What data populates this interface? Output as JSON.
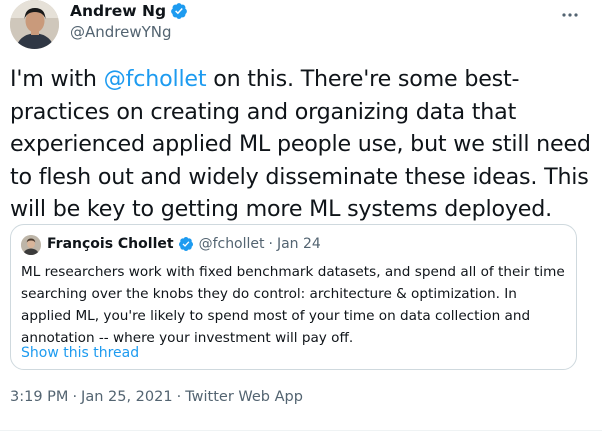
{
  "author": {
    "name": "Andrew Ng",
    "handle": "@AndrewYNg"
  },
  "tweet": {
    "text_before": "I'm with ",
    "mention": "@fchollet",
    "text_after": " on this. There're some best-practices on creating and organizing data that experienced applied ML people use, but we still need to flesh out and widely disseminate these ideas. This will be key to getting more ML systems deployed."
  },
  "quote": {
    "name": "François Chollet",
    "handle": "@fchollet",
    "date": "Jan 24",
    "text": "ML researchers work with fixed benchmark datasets, and spend all of their time searching over the knobs they do control: architecture & optimization. In applied ML, you're likely to spend most of your time on data collection and annotation -- where your investment will pay off.",
    "show_thread": "Show this thread"
  },
  "meta": {
    "time": "3:19 PM",
    "date": "Jan 25, 2021",
    "app": "Twitter Web App"
  },
  "colors": {
    "link": "#1d9bf0",
    "secondary_text": "#536471",
    "border": "#cfd9de"
  },
  "icons": {
    "verified": "verified-badge-icon",
    "more": "more-options-icon"
  }
}
